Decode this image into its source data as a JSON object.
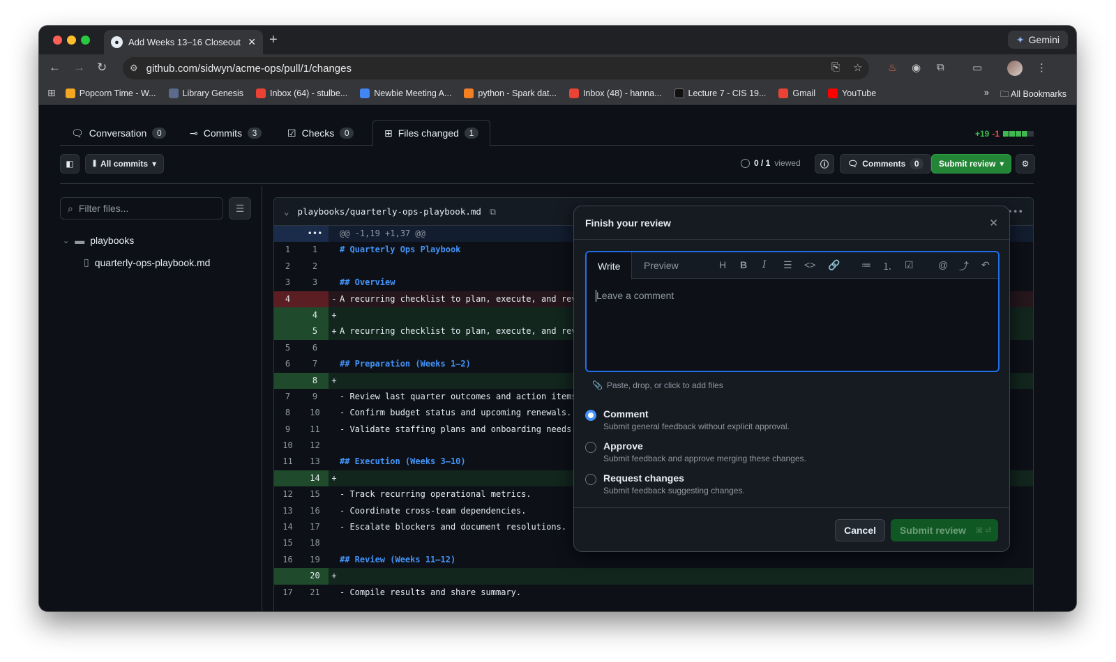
{
  "browser": {
    "tab_title": "Add Weeks 13–16 Closeout &",
    "new_tab": "+",
    "gemini_label": "Gemini",
    "url": "github.com/sidwyn/acme-ops/pull/1/changes",
    "bookmarks": [
      {
        "label": "Popcorn Time - W...",
        "color": "#f5a623"
      },
      {
        "label": "Library Genesis",
        "color": "#5b6b8c"
      },
      {
        "label": "Inbox (64) - stulbe...",
        "color": "#ea4335"
      },
      {
        "label": "Newbie Meeting A...",
        "color": "#4285f4"
      },
      {
        "label": "python - Spark dat...",
        "color": "#f48024"
      },
      {
        "label": "Inbox (48) - hanna...",
        "color": "#ea4335"
      },
      {
        "label": "Lecture 7 - CIS 19...",
        "color": "#111111"
      },
      {
        "label": "Gmail",
        "color": "#ea4335"
      },
      {
        "label": "YouTube",
        "color": "#ff0000"
      }
    ],
    "more": "»",
    "all_bookmarks": "All Bookmarks"
  },
  "pr_tabs": [
    {
      "label": "Conversation",
      "count": "0"
    },
    {
      "label": "Commits",
      "count": "3"
    },
    {
      "label": "Checks",
      "count": "0"
    },
    {
      "label": "Files changed",
      "count": "1"
    }
  ],
  "stats": {
    "additions": "+19",
    "deletions": "-1"
  },
  "subbar": {
    "all_commits": "All commits",
    "viewed_count": "0 / 1",
    "viewed_label": "viewed",
    "comments_label": "Comments",
    "comments_count": "0",
    "submit_review": "Submit review"
  },
  "tree": {
    "filter_placeholder": "Filter files...",
    "folder": "playbooks",
    "file": "quarterly-ops-playbook.md"
  },
  "diff": {
    "file_path": "playbooks/quarterly-ops-playbook.md",
    "hunk": "@@ -1,19 +1,37 @@",
    "hunk_more": "•••",
    "rows": [
      {
        "type": "ctx",
        "old": "1",
        "new": "1",
        "sign": "",
        "text": "# Quarterly Ops Playbook",
        "heading": true
      },
      {
        "type": "ctx",
        "old": "2",
        "new": "2",
        "sign": "",
        "text": "",
        "heading": false
      },
      {
        "type": "ctx",
        "old": "3",
        "new": "3",
        "sign": "",
        "text": "## Overview",
        "heading": true
      },
      {
        "type": "del",
        "old": "4",
        "new": "",
        "sign": "-",
        "text": "A recurring checklist to plan, execute, and rev",
        "heading": false
      },
      {
        "type": "add",
        "old": "",
        "new": "4",
        "sign": "+",
        "text": "",
        "heading": false
      },
      {
        "type": "add",
        "old": "",
        "new": "5",
        "sign": "+",
        "text": "A recurring checklist to plan, execute, and rev",
        "heading": false
      },
      {
        "type": "ctx",
        "old": "5",
        "new": "6",
        "sign": "",
        "text": "",
        "heading": false
      },
      {
        "type": "ctx",
        "old": "6",
        "new": "7",
        "sign": "",
        "text": "## Preparation (Weeks 1–2)",
        "heading": true
      },
      {
        "type": "add",
        "old": "",
        "new": "8",
        "sign": "+",
        "text": "",
        "heading": false
      },
      {
        "type": "ctx",
        "old": "7",
        "new": "9",
        "sign": "",
        "text": "- Review last quarter outcomes and action items",
        "heading": false
      },
      {
        "type": "ctx",
        "old": "8",
        "new": "10",
        "sign": "",
        "text": "- Confirm budget status and upcoming renewals.",
        "heading": false
      },
      {
        "type": "ctx",
        "old": "9",
        "new": "11",
        "sign": "",
        "text": "- Validate staffing plans and onboarding needs.",
        "heading": false
      },
      {
        "type": "ctx",
        "old": "10",
        "new": "12",
        "sign": "",
        "text": "",
        "heading": false
      },
      {
        "type": "ctx",
        "old": "11",
        "new": "13",
        "sign": "",
        "text": "## Execution (Weeks 3–10)",
        "heading": true
      },
      {
        "type": "add",
        "old": "",
        "new": "14",
        "sign": "+",
        "text": "",
        "heading": false
      },
      {
        "type": "ctx",
        "old": "12",
        "new": "15",
        "sign": "",
        "text": "- Track recurring operational metrics.",
        "heading": false
      },
      {
        "type": "ctx",
        "old": "13",
        "new": "16",
        "sign": "",
        "text": "- Coordinate cross-team dependencies.",
        "heading": false
      },
      {
        "type": "ctx",
        "old": "14",
        "new": "17",
        "sign": "",
        "text": "- Escalate blockers and document resolutions.",
        "heading": false
      },
      {
        "type": "ctx",
        "old": "15",
        "new": "18",
        "sign": "",
        "text": "",
        "heading": false
      },
      {
        "type": "ctx",
        "old": "16",
        "new": "19",
        "sign": "",
        "text": "## Review (Weeks 11–12)",
        "heading": true
      },
      {
        "type": "add",
        "old": "",
        "new": "20",
        "sign": "+",
        "text": "",
        "heading": false
      },
      {
        "type": "ctx",
        "old": "17",
        "new": "21",
        "sign": "",
        "text": "- Compile results and share summary.",
        "heading": false
      }
    ]
  },
  "review": {
    "title": "Finish your review",
    "tab_write": "Write",
    "tab_preview": "Preview",
    "placeholder": "Leave a comment",
    "attach": "Paste, drop, or click to add files",
    "options": [
      {
        "title": "Comment",
        "desc": "Submit general feedback without explicit approval.",
        "selected": true
      },
      {
        "title": "Approve",
        "desc": "Submit feedback and approve merging these changes.",
        "selected": false
      },
      {
        "title": "Request changes",
        "desc": "Submit feedback suggesting changes.",
        "selected": false
      }
    ],
    "cancel": "Cancel",
    "submit": "Submit review",
    "submit_shortcut": "⌘ ⏎"
  },
  "colors": {
    "accent": "#1f6feb",
    "add": "#3fb950",
    "del": "#f85149",
    "primary_button": "#238636"
  }
}
